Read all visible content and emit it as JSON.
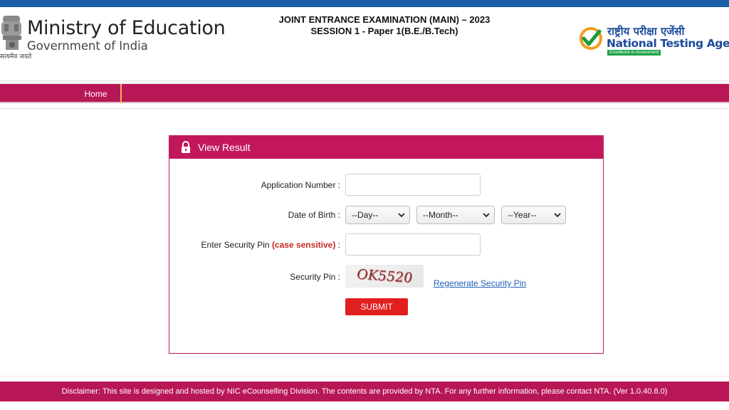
{
  "header": {
    "emblem_motto": "सत्यमेव जयते",
    "ministry_title": "Ministry of Education",
    "ministry_subtitle": "Government of India",
    "exam_line1": "JOINT ENTRANCE EXAMINATION (MAIN) – 2023",
    "exam_line2": "SESSION 1 - Paper 1(B.E./B.Tech)",
    "agency_hindi": "राष्ट्रीय परीक्षा एजेंसी",
    "agency_name": "National Testing Agency",
    "agency_tagline": "Excellence in Assessment"
  },
  "nav": {
    "home_label": "Home"
  },
  "form": {
    "title": "View Result",
    "application_number_label": "Application Number :",
    "application_number_value": "",
    "dob_label": "Date of Birth :",
    "day_selected": "--Day--",
    "month_selected": "--Month--",
    "year_selected": "--Year--",
    "security_pin_entry_label": "Enter Security Pin",
    "case_sensitive_note": "(case sensitive)",
    "security_pin_entry_colon": " :",
    "security_pin_value": "",
    "security_pin_label": "Security Pin :",
    "captcha_text": "OK5520",
    "regenerate_label": "Regenerate Security Pin",
    "submit_label": "SUBMIT"
  },
  "footer": {
    "disclaimer": "Disclaimer: This site is designed and hosted by NIC eCounselling Division. The contents are provided by NTA. For any further information, please contact NTA. (Ver 1.0.40.8.0)"
  },
  "colors": {
    "top_bar": "#1a5ea8",
    "brand_magenta": "#b81756",
    "panel_accent": "#c2185b",
    "submit_red": "#e11f1f",
    "link_blue": "#1c5fb8"
  },
  "icons": {
    "emblem": "national-emblem-icon",
    "agency_logo": "nta-checkmark-icon",
    "lock": "lock-icon",
    "dropdown": "chevron-down-icon"
  }
}
